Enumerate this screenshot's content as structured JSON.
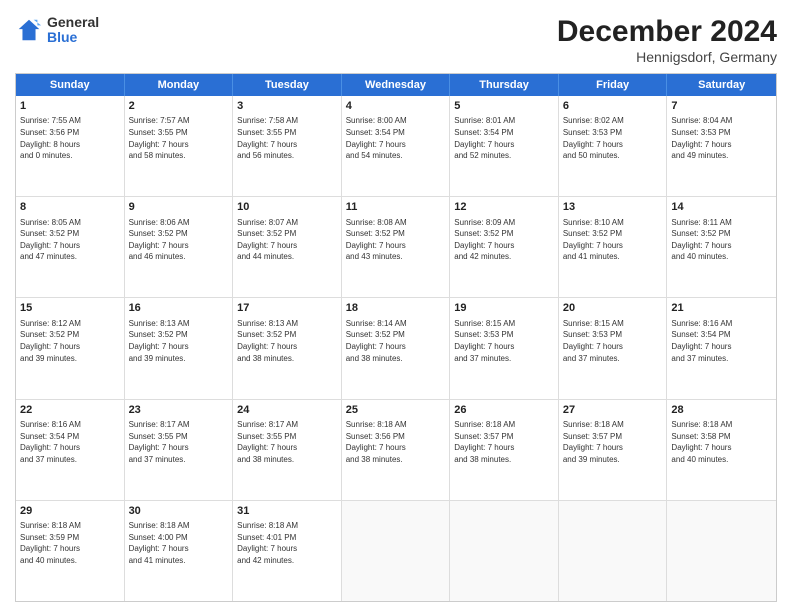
{
  "header": {
    "logo": {
      "general": "General",
      "blue": "Blue"
    },
    "title": "December 2024",
    "location": "Hennigsdorf, Germany"
  },
  "weekdays": [
    "Sunday",
    "Monday",
    "Tuesday",
    "Wednesday",
    "Thursday",
    "Friday",
    "Saturday"
  ],
  "rows": [
    [
      {
        "day": "1",
        "sunrise": "Sunrise: 7:55 AM",
        "sunset": "Sunset: 3:56 PM",
        "daylight": "Daylight: 8 hours and 0 minutes."
      },
      {
        "day": "2",
        "sunrise": "Sunrise: 7:57 AM",
        "sunset": "Sunset: 3:55 PM",
        "daylight": "Daylight: 7 hours and 58 minutes."
      },
      {
        "day": "3",
        "sunrise": "Sunrise: 7:58 AM",
        "sunset": "Sunset: 3:55 PM",
        "daylight": "Daylight: 7 hours and 56 minutes."
      },
      {
        "day": "4",
        "sunrise": "Sunrise: 8:00 AM",
        "sunset": "Sunset: 3:54 PM",
        "daylight": "Daylight: 7 hours and 54 minutes."
      },
      {
        "day": "5",
        "sunrise": "Sunrise: 8:01 AM",
        "sunset": "Sunset: 3:54 PM",
        "daylight": "Daylight: 7 hours and 52 minutes."
      },
      {
        "day": "6",
        "sunrise": "Sunrise: 8:02 AM",
        "sunset": "Sunset: 3:53 PM",
        "daylight": "Daylight: 7 hours and 50 minutes."
      },
      {
        "day": "7",
        "sunrise": "Sunrise: 8:04 AM",
        "sunset": "Sunset: 3:53 PM",
        "daylight": "Daylight: 7 hours and 49 minutes."
      }
    ],
    [
      {
        "day": "8",
        "sunrise": "Sunrise: 8:05 AM",
        "sunset": "Sunset: 3:52 PM",
        "daylight": "Daylight: 7 hours and 47 minutes."
      },
      {
        "day": "9",
        "sunrise": "Sunrise: 8:06 AM",
        "sunset": "Sunset: 3:52 PM",
        "daylight": "Daylight: 7 hours and 46 minutes."
      },
      {
        "day": "10",
        "sunrise": "Sunrise: 8:07 AM",
        "sunset": "Sunset: 3:52 PM",
        "daylight": "Daylight: 7 hours and 44 minutes."
      },
      {
        "day": "11",
        "sunrise": "Sunrise: 8:08 AM",
        "sunset": "Sunset: 3:52 PM",
        "daylight": "Daylight: 7 hours and 43 minutes."
      },
      {
        "day": "12",
        "sunrise": "Sunrise: 8:09 AM",
        "sunset": "Sunset: 3:52 PM",
        "daylight": "Daylight: 7 hours and 42 minutes."
      },
      {
        "day": "13",
        "sunrise": "Sunrise: 8:10 AM",
        "sunset": "Sunset: 3:52 PM",
        "daylight": "Daylight: 7 hours and 41 minutes."
      },
      {
        "day": "14",
        "sunrise": "Sunrise: 8:11 AM",
        "sunset": "Sunset: 3:52 PM",
        "daylight": "Daylight: 7 hours and 40 minutes."
      }
    ],
    [
      {
        "day": "15",
        "sunrise": "Sunrise: 8:12 AM",
        "sunset": "Sunset: 3:52 PM",
        "daylight": "Daylight: 7 hours and 39 minutes."
      },
      {
        "day": "16",
        "sunrise": "Sunrise: 8:13 AM",
        "sunset": "Sunset: 3:52 PM",
        "daylight": "Daylight: 7 hours and 39 minutes."
      },
      {
        "day": "17",
        "sunrise": "Sunrise: 8:13 AM",
        "sunset": "Sunset: 3:52 PM",
        "daylight": "Daylight: 7 hours and 38 minutes."
      },
      {
        "day": "18",
        "sunrise": "Sunrise: 8:14 AM",
        "sunset": "Sunset: 3:52 PM",
        "daylight": "Daylight: 7 hours and 38 minutes."
      },
      {
        "day": "19",
        "sunrise": "Sunrise: 8:15 AM",
        "sunset": "Sunset: 3:53 PM",
        "daylight": "Daylight: 7 hours and 37 minutes."
      },
      {
        "day": "20",
        "sunrise": "Sunrise: 8:15 AM",
        "sunset": "Sunset: 3:53 PM",
        "daylight": "Daylight: 7 hours and 37 minutes."
      },
      {
        "day": "21",
        "sunrise": "Sunrise: 8:16 AM",
        "sunset": "Sunset: 3:54 PM",
        "daylight": "Daylight: 7 hours and 37 minutes."
      }
    ],
    [
      {
        "day": "22",
        "sunrise": "Sunrise: 8:16 AM",
        "sunset": "Sunset: 3:54 PM",
        "daylight": "Daylight: 7 hours and 37 minutes."
      },
      {
        "day": "23",
        "sunrise": "Sunrise: 8:17 AM",
        "sunset": "Sunset: 3:55 PM",
        "daylight": "Daylight: 7 hours and 37 minutes."
      },
      {
        "day": "24",
        "sunrise": "Sunrise: 8:17 AM",
        "sunset": "Sunset: 3:55 PM",
        "daylight": "Daylight: 7 hours and 38 minutes."
      },
      {
        "day": "25",
        "sunrise": "Sunrise: 8:18 AM",
        "sunset": "Sunset: 3:56 PM",
        "daylight": "Daylight: 7 hours and 38 minutes."
      },
      {
        "day": "26",
        "sunrise": "Sunrise: 8:18 AM",
        "sunset": "Sunset: 3:57 PM",
        "daylight": "Daylight: 7 hours and 38 minutes."
      },
      {
        "day": "27",
        "sunrise": "Sunrise: 8:18 AM",
        "sunset": "Sunset: 3:57 PM",
        "daylight": "Daylight: 7 hours and 39 minutes."
      },
      {
        "day": "28",
        "sunrise": "Sunrise: 8:18 AM",
        "sunset": "Sunset: 3:58 PM",
        "daylight": "Daylight: 7 hours and 40 minutes."
      }
    ],
    [
      {
        "day": "29",
        "sunrise": "Sunrise: 8:18 AM",
        "sunset": "Sunset: 3:59 PM",
        "daylight": "Daylight: 7 hours and 40 minutes."
      },
      {
        "day": "30",
        "sunrise": "Sunrise: 8:18 AM",
        "sunset": "Sunset: 4:00 PM",
        "daylight": "Daylight: 7 hours and 41 minutes."
      },
      {
        "day": "31",
        "sunrise": "Sunrise: 8:18 AM",
        "sunset": "Sunset: 4:01 PM",
        "daylight": "Daylight: 7 hours and 42 minutes."
      },
      null,
      null,
      null,
      null
    ]
  ]
}
